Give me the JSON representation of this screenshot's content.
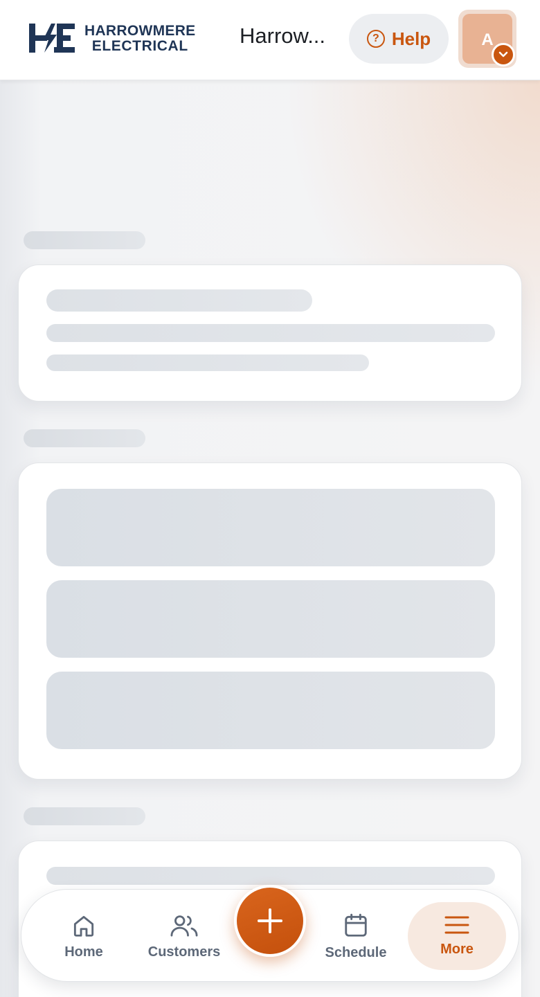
{
  "header": {
    "logo": {
      "line1": "HARROWMERE",
      "line2": "ELECTRICAL",
      "mark": "HE"
    },
    "company_name": "Harrow...",
    "help": {
      "label": "Help",
      "icon": "help-circle-icon"
    },
    "avatar": {
      "initial": "A",
      "badge_icon": "chevron-down-icon"
    }
  },
  "colors": {
    "accent": "#c9560f",
    "brand_navy": "#1f3556",
    "skeleton": "#dde1e6",
    "nav_text": "#5d6878"
  },
  "bottom_nav": {
    "items": [
      {
        "label": "Home",
        "icon": "home-icon"
      },
      {
        "label": "Customers",
        "icon": "users-icon"
      },
      {
        "label": "Schedule",
        "icon": "calendar-icon"
      },
      {
        "label": "More",
        "icon": "menu-icon",
        "active": true
      }
    ],
    "fab": {
      "icon": "plus-icon"
    }
  }
}
